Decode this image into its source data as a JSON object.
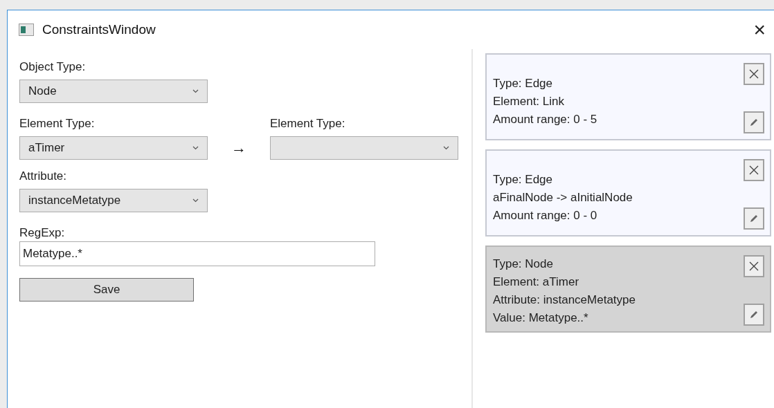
{
  "window": {
    "title": "ConstraintsWindow",
    "close": "×"
  },
  "form": {
    "object_type": {
      "label": "Object Type:",
      "value": "Node"
    },
    "element_type": {
      "label": "Element Type:",
      "value": "aTimer"
    },
    "arrow": "→",
    "target_element_type": {
      "label": "Element Type:"
    },
    "attribute": {
      "label": "Attribute:",
      "value": "instanceMetatype"
    },
    "regexp": {
      "label": "RegExp:",
      "value": "Metatype..*"
    },
    "save_button": "Save"
  },
  "constraints": [
    {
      "lines": [
        "Type: Edge",
        "Element: Link",
        "Amount range: 0 - 5"
      ],
      "selected": false
    },
    {
      "lines": [
        "Type: Edge",
        "aFinalNode -> aInitialNode",
        "Amount range: 0 - 0"
      ],
      "selected": false
    },
    {
      "lines": [
        "Type: Node",
        "Element: aTimer",
        "Attribute: instanceMetatype",
        "Value: Metatype..*"
      ],
      "selected": true
    }
  ]
}
